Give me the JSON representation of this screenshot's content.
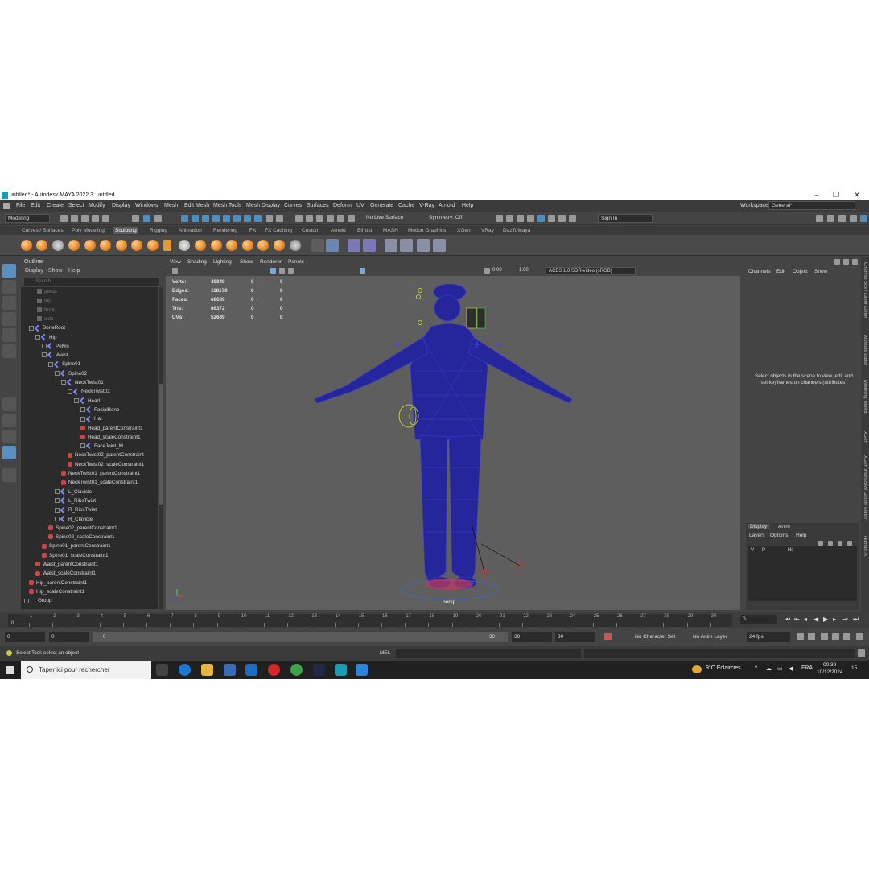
{
  "window": {
    "title": "untitled* - Autodesk MAYA 2022.3: untitled",
    "controls": [
      "–",
      "❐",
      "✕"
    ]
  },
  "menu": [
    "File",
    "Edit",
    "Create",
    "Select",
    "Modify",
    "Display",
    "Windows",
    "Mesh",
    "Edit Mesh",
    "Mesh Tools",
    "Mesh Display",
    "Curves",
    "Surfaces",
    "Deform",
    "UV",
    "Generate",
    "Cache",
    "V-Ray",
    "Arnold",
    "Help"
  ],
  "workspace": {
    "label": "Workspace:",
    "value": "General*"
  },
  "toolbar": {
    "mode": "Modeling",
    "live_surface": "No Live Surface",
    "symmetry": "Symmetry: Off",
    "sign_in": "Sign In"
  },
  "shelf_tabs": [
    "Curves / Surfaces",
    "Poly Modeling",
    "Sculpting",
    "Rigging",
    "Animation",
    "Rendering",
    "FX",
    "FX Caching",
    "Custom",
    "Arnold",
    "Bifrost",
    "MASH",
    "Motion Graphics",
    "XGen",
    "VRay",
    "DazToMaya"
  ],
  "shelf_active": "Sculpting",
  "outliner": {
    "title": "Outliner",
    "menus": [
      "Display",
      "Show",
      "Help"
    ],
    "search_placeholder": "Search...",
    "nodes": [
      {
        "label": "persp",
        "type": "cam"
      },
      {
        "label": "top",
        "type": "cam"
      },
      {
        "label": "front",
        "type": "cam"
      },
      {
        "label": "side",
        "type": "cam"
      },
      {
        "label": "BoneRoot",
        "type": "bone"
      },
      {
        "label": "Hip",
        "type": "bone"
      },
      {
        "label": "Pelvis",
        "type": "bone"
      },
      {
        "label": "Waist",
        "type": "bone"
      },
      {
        "label": "Spine01",
        "type": "bone"
      },
      {
        "label": "Spine02",
        "type": "bone"
      },
      {
        "label": "NeckTwist01",
        "type": "bone"
      },
      {
        "label": "NeckTwist02",
        "type": "bone"
      },
      {
        "label": "Head",
        "type": "bone"
      },
      {
        "label": "FacialBone",
        "type": "bone"
      },
      {
        "label": "Hat",
        "type": "bone"
      },
      {
        "label": "Head_parentConstraint1",
        "type": "cons"
      },
      {
        "label": "Head_scaleConstraint1",
        "type": "cons"
      },
      {
        "label": "FaceJoint_M",
        "type": "bone"
      },
      {
        "label": "NeckTwist02_parentConstraint",
        "type": "cons"
      },
      {
        "label": "NeckTwist02_scaleConstraint1",
        "type": "cons"
      },
      {
        "label": "NeckTwist01_parentConstraint1",
        "type": "cons"
      },
      {
        "label": "NeckTwist01_scaleConstraint1",
        "type": "cons"
      },
      {
        "label": "L_Clavicle",
        "type": "bone"
      },
      {
        "label": "L_RibsTwist",
        "type": "bone"
      },
      {
        "label": "R_RibsTwist",
        "type": "bone"
      },
      {
        "label": "R_Clavicle",
        "type": "bone"
      },
      {
        "label": "Spine02_parentConstraint1",
        "type": "cons"
      },
      {
        "label": "Spine02_scaleConstraint1",
        "type": "cons"
      },
      {
        "label": "Spine01_parentConstraint1",
        "type": "cons"
      },
      {
        "label": "Spine01_scaleConstraint1",
        "type": "cons"
      },
      {
        "label": "Waist_parentConstraint1",
        "type": "cons"
      },
      {
        "label": "Waist_scaleConstraint1",
        "type": "cons"
      },
      {
        "label": "Hip_parentConstraint1",
        "type": "cons"
      },
      {
        "label": "Hip_scaleConstraint1",
        "type": "cons"
      },
      {
        "label": "Group",
        "type": "grp"
      }
    ]
  },
  "viewport": {
    "menus": [
      "View",
      "Shading",
      "Lighting",
      "Show",
      "Renderer",
      "Panels"
    ],
    "exposure": "0.00",
    "gamma": "1.00",
    "colorspace": "ACES 1.0 SDR-video (sRGB)",
    "camera_label": "persp",
    "stats": [
      {
        "label": "Verts:",
        "v1": "49849",
        "v2": "0",
        "v3": "0"
      },
      {
        "label": "Edges:",
        "v1": "118170",
        "v2": "0",
        "v3": "0"
      },
      {
        "label": "Faces:",
        "v1": "68689",
        "v2": "0",
        "v3": "0"
      },
      {
        "label": "Tris:",
        "v1": "86372",
        "v2": "0",
        "v3": "0"
      },
      {
        "label": "UVs:",
        "v1": "52689",
        "v2": "0",
        "v3": "0"
      }
    ]
  },
  "channel_box": {
    "menus": [
      "Channels",
      "Edit",
      "Object",
      "Show"
    ],
    "empty_message": "Select objects in the scene to view, edit and set keyframes on channels (attributes)"
  },
  "layers": {
    "tabs": [
      "Display",
      "Anim"
    ],
    "menus": [
      "Layers",
      "Options",
      "Help"
    ],
    "row": {
      "v": "V",
      "p": "P",
      "name": "Hi"
    }
  },
  "side_tabs": [
    "Channel Box / Layer Editor",
    "Attribute Editor",
    "Modeling Toolkit",
    "XGen",
    "XGen Interactive Groom Editor",
    "Human IK"
  ],
  "timeline": {
    "ticks": [
      "1",
      "2",
      "3",
      "4",
      "5",
      "6",
      "7",
      "8",
      "9",
      "10",
      "11",
      "12",
      "13",
      "14",
      "15",
      "16",
      "17",
      "18",
      "19",
      "20",
      "21",
      "22",
      "23",
      "24",
      "25",
      "26",
      "27",
      "28",
      "29",
      "30"
    ],
    "start_marker": "0",
    "current_frame": "0"
  },
  "range": {
    "start": "0",
    "anim_start": "0",
    "slider_start": "0",
    "slider_end": "30",
    "anim_end": "30",
    "end": "30",
    "character_set": "No Character Set",
    "anim_layer": "No Anim Layer",
    "fps": "24 fps"
  },
  "command": {
    "lang": "MEL",
    "help": "Select Tool: select an object"
  },
  "taskbar": {
    "search_placeholder": "Taper ici pour rechercher",
    "weather": "9°C  Eclaircies",
    "lang": "FRA",
    "time": "00:39",
    "date": "10/12/2024",
    "notif": "15"
  },
  "colors": {
    "accent": "#5b8fbf",
    "wireframe": "#1e1e9e",
    "maya_logo": "#1ab0c8"
  }
}
